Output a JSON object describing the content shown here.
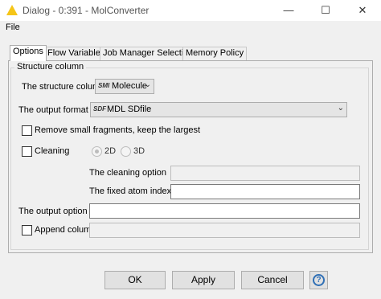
{
  "window": {
    "title": "Dialog - 0:391 - MolConverter",
    "minimize_glyph": "—",
    "maximize_glyph": "☐",
    "close_glyph": "✕"
  },
  "menu": {
    "file": "File"
  },
  "tabs": [
    {
      "label": "Options",
      "active": true
    },
    {
      "label": "Flow Variables",
      "active": false
    },
    {
      "label": "Job Manager Selection",
      "active": false
    },
    {
      "label": "Memory Policy",
      "active": false
    }
  ],
  "form": {
    "group_title": "Structure column",
    "structure_column": {
      "label": "The structure column",
      "type_badge": "SMI",
      "value": "Molecule"
    },
    "output_format": {
      "label": "The output format",
      "type_badge": "SDF",
      "value": "MDL SDfile"
    },
    "remove_fragments": {
      "label": "Remove small fragments, keep the largest",
      "checked": false
    },
    "cleaning": {
      "label": "Cleaning",
      "checked": false,
      "options": [
        "2D",
        "3D"
      ],
      "selected": "2D"
    },
    "cleaning_option": {
      "label": "The cleaning option",
      "value": ""
    },
    "fixed_atoms": {
      "label": "The fixed atom indexes",
      "value": ""
    },
    "output_option": {
      "label": "The output option",
      "value": ""
    },
    "append_column": {
      "label": "Append column",
      "checked": false,
      "value": ""
    }
  },
  "buttons": {
    "ok": "OK",
    "apply": "Apply",
    "cancel": "Cancel",
    "help": "?"
  },
  "colors": {
    "app_icon": "#f5c518",
    "help_icon": "#2f6fb5"
  }
}
